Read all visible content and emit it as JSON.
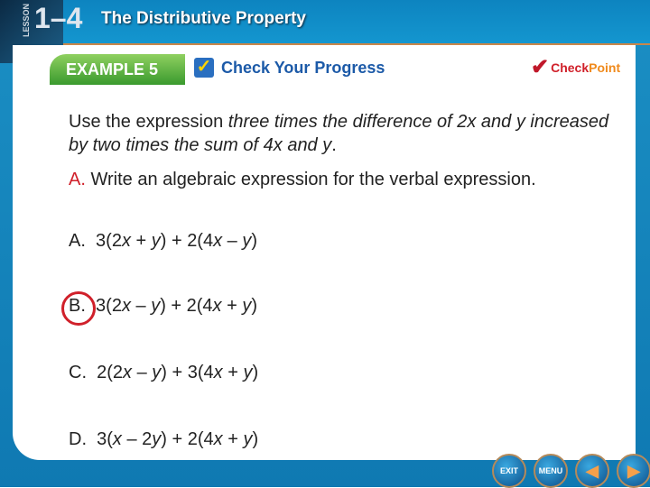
{
  "header": {
    "lesson_word": "LESSON",
    "lesson_number": "1–4",
    "title": "The Distributive Property"
  },
  "banner": {
    "example": "EXAMPLE 5",
    "check_progress": "Check Your Progress",
    "checkpoint_a": "Check",
    "checkpoint_b": "Point"
  },
  "question": {
    "p1": "Use the expression ",
    "p1i": "three times the difference of 2x and y increased by two times the sum of 4x and y",
    "p1end": ".",
    "part_label": "A.",
    "part_text": " Write an algebraic expression for the verbal expression."
  },
  "options": [
    {
      "letter": "A.",
      "parts": [
        "3(2",
        "x",
        " + ",
        "y",
        ") + 2(4",
        "x",
        " – ",
        "y",
        ")"
      ]
    },
    {
      "letter": "B.",
      "parts": [
        "3(2",
        "x",
        " – ",
        "y",
        ") + 2(4",
        "x",
        " + ",
        "y",
        ")"
      ]
    },
    {
      "letter": "C.",
      "parts": [
        "2(2",
        "x",
        " – ",
        "y",
        ") + 3(4",
        "x",
        " + ",
        "y",
        ")"
      ]
    },
    {
      "letter": "D.",
      "parts": [
        "3(",
        "x",
        " – 2",
        "y",
        ") + 2(4",
        "x",
        " + ",
        "y",
        ")"
      ]
    }
  ],
  "selected": "B",
  "nav": {
    "exit": "EXIT",
    "menu": "MENU",
    "prev_icon": "triangle-left-icon",
    "next_icon": "triangle-right-icon"
  },
  "colors": {
    "accent_red": "#d0202a",
    "header_blue": "#1496cf",
    "badge_green": "#3a9a2e"
  }
}
